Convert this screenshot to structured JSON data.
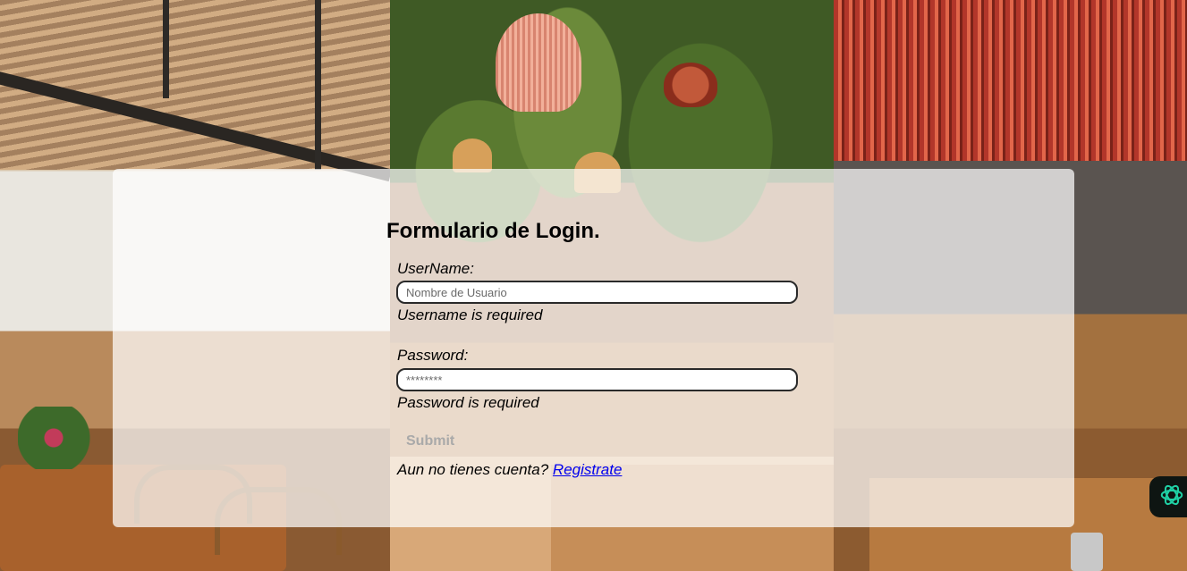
{
  "form": {
    "title": "Formulario de Login.",
    "username": {
      "label": "UserName:",
      "placeholder": "Nombre de Usuario",
      "value": "",
      "error": "Username is required"
    },
    "password": {
      "label": "Password:",
      "placeholder": "********",
      "value": "",
      "error": "Password is required"
    },
    "submit_label": "Submit",
    "signup": {
      "prompt": "Aun no tienes cuenta?",
      "link_label": "Registrate"
    }
  },
  "colors": {
    "link": "#0000ee",
    "submit_disabled_text": "#a9a9a9",
    "assistant_icon": "#1fd1a5"
  },
  "icons": {
    "floating_button": "openai-assistant-icon"
  }
}
